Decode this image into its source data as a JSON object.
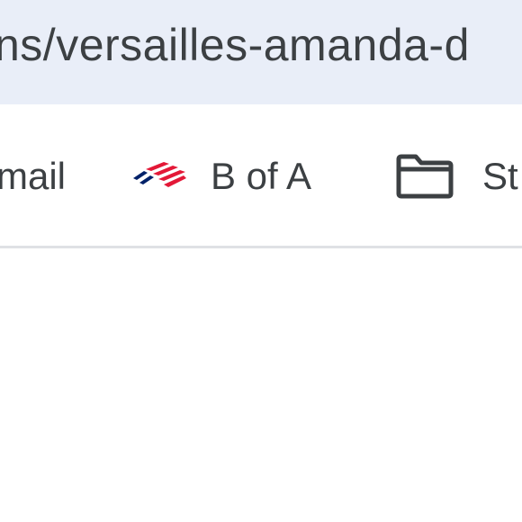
{
  "address_bar": {
    "url_fragment": "ns/versailles-amanda-d"
  },
  "bookmarks": [
    {
      "label": "mail",
      "icon": "gmail-icon"
    },
    {
      "label": "B of A",
      "icon": "bank-of-america-flag-icon"
    },
    {
      "label": "St",
      "icon": "folder-icon"
    }
  ],
  "colors": {
    "address_bar_bg": "#e9eef8",
    "text": "#3c4043",
    "divider": "#dfe1e5",
    "bofa_red": "#e31837",
    "bofa_blue": "#012169"
  }
}
